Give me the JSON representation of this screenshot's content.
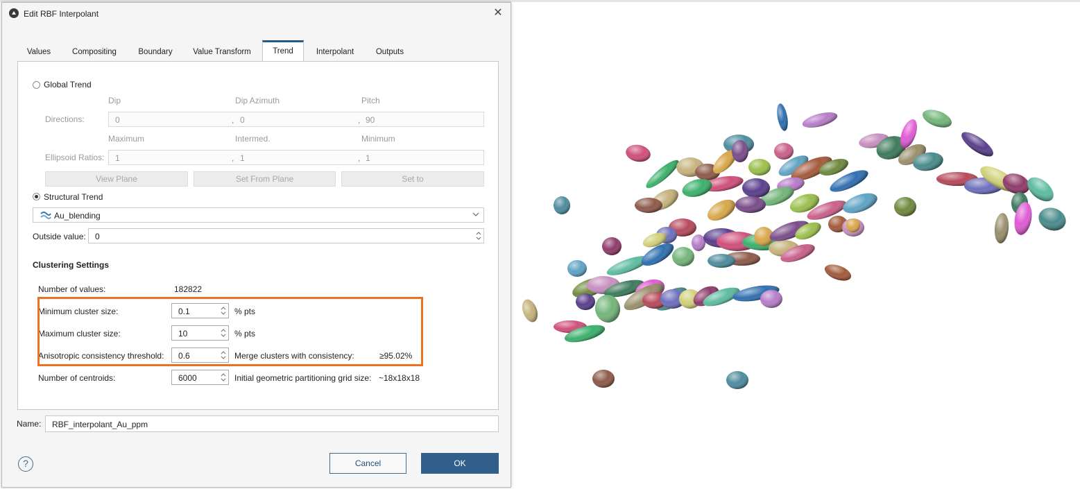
{
  "dialog": {
    "title": "Edit RBF Interpolant",
    "tabs": [
      {
        "label": "Values"
      },
      {
        "label": "Compositing"
      },
      {
        "label": "Boundary"
      },
      {
        "label": "Value Transform"
      },
      {
        "label": "Trend",
        "active": true
      },
      {
        "label": "Interpolant"
      },
      {
        "label": "Outputs"
      }
    ],
    "global_trend": {
      "label": "Global Trend",
      "selected": false,
      "directions_label": "Directions:",
      "direction_headers": [
        "Dip",
        "Dip Azimuth",
        "Pitch"
      ],
      "direction_values": [
        "0",
        "0",
        "90"
      ],
      "ratios_label": "Ellipsoid Ratios:",
      "ratio_headers": [
        "Maximum",
        "Intermed.",
        "Minimum"
      ],
      "ratio_values": [
        "1",
        "1",
        "1"
      ],
      "buttons": [
        "View Plane",
        "Set From Plane",
        "Set to"
      ]
    },
    "structural_trend": {
      "label": "Structural Trend",
      "selected": true,
      "selected_value": "Au_blending",
      "outside_value_label": "Outside value:",
      "outside_value": "0"
    },
    "clustering": {
      "heading": "Clustering Settings",
      "number_of_values_label": "Number of values:",
      "number_of_values": "182822",
      "min_cluster_label": "Minimum cluster size:",
      "min_cluster_value": "0.1",
      "min_cluster_unit": "% pts",
      "max_cluster_label": "Maximum cluster size:",
      "max_cluster_value": "10",
      "max_cluster_unit": "% pts",
      "aniso_label": "Anisotropic consistency threshold:",
      "aniso_value": "0.6",
      "merge_label": "Merge clusters with consistency:",
      "merge_value": "≥95.02%",
      "centroids_label": "Number of centroids:",
      "centroids_value": "6000",
      "grid_label": "Initial geometric partitioning grid size:",
      "grid_value": "~18x18x18"
    },
    "name_label": "Name:",
    "name_value": "RBF_interpolant_Au_ppm",
    "cancel_label": "Cancel",
    "ok_label": "OK",
    "help_icon": "?",
    "close_icon": "✕",
    "accent_color": "#2f5f8a",
    "highlight_color": "#ec7223"
  }
}
